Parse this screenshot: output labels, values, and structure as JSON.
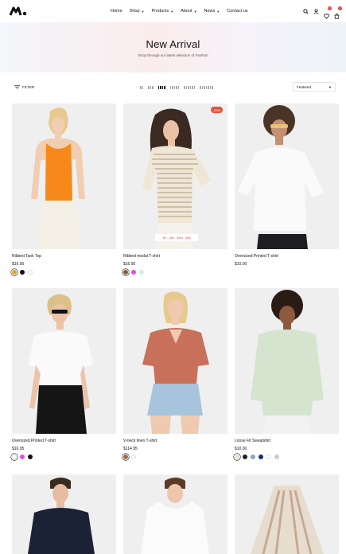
{
  "header": {
    "nav": [
      {
        "label": "Home",
        "caret": false
      },
      {
        "label": "Shop",
        "caret": true
      },
      {
        "label": "Products",
        "caret": true
      },
      {
        "label": "About",
        "caret": true
      },
      {
        "label": "News",
        "caret": true
      },
      {
        "label": "Contact us",
        "caret": false
      }
    ],
    "wishlist_count": "0",
    "cart_count": "0",
    "icons": [
      "search-icon",
      "user-icon",
      "heart-icon",
      "cart-icon"
    ]
  },
  "hero": {
    "title": "New Arrival",
    "subtitle": "Shop through our latest selection of Fashion"
  },
  "toolbar": {
    "filter_label": "FILTER",
    "sort_value": "Featured"
  },
  "products": [
    {
      "name": "Ribbed Tank Top",
      "price": "$16.95",
      "swatches": [
        "#d7a43a",
        "#111111",
        "#ffffff"
      ]
    },
    {
      "name": "Ribbed modal T-shirt",
      "price": "$16.95",
      "sale": "-33%",
      "timer": "9d : 18h : 50m : 40s",
      "swatches": [
        "#8b5a3c",
        "#d855d8",
        "#cfeee6"
      ]
    },
    {
      "name": "Oversized Printed T-shirt",
      "price": "$10.00",
      "swatches": []
    },
    {
      "name": "Oversized Printed T-shirt",
      "price": "$16.95",
      "swatches": [
        "#ffffff",
        "#d855d8",
        "#111111"
      ]
    },
    {
      "name": "V-neck linen T-shirt",
      "price": "$114.95",
      "swatches": [
        "#9c6b4a",
        "#ffffff"
      ]
    },
    {
      "name": "Loose Fit Sweatshirt",
      "price": "$10.00",
      "swatches": [
        "#d9e8d3",
        "#222222",
        "#8aa6c8",
        "#1b2a6b",
        "#ffffff",
        "#cccccc"
      ]
    },
    {
      "name": "",
      "price": "",
      "swatches": []
    },
    {
      "name": "",
      "price": "",
      "swatches": []
    },
    {
      "name": "",
      "price": "",
      "swatches": []
    }
  ],
  "colors": {
    "accent": "#e53935",
    "sale": "#e8503a",
    "hero_pink": "#fbecec"
  }
}
